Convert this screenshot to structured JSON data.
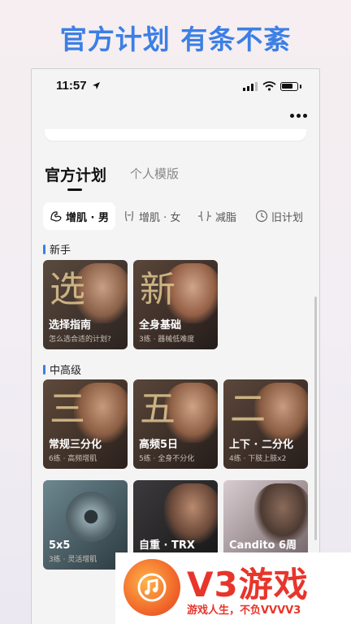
{
  "headline": "官方计划 有条不紊",
  "status": {
    "time": "11:57"
  },
  "tabs": {
    "official": "官方计划",
    "personal": "个人模版"
  },
  "chips": [
    {
      "label": "增肌 · 男",
      "icon": "muscle-arm-icon"
    },
    {
      "label": "增肌 · 女",
      "icon": "female-torso-icon"
    },
    {
      "label": "减脂",
      "icon": "fat-loss-icon"
    },
    {
      "label": "旧计划",
      "icon": "clock-icon"
    }
  ],
  "sections": {
    "beginner": "新手",
    "advanced": "中高级"
  },
  "beginner_cards": [
    {
      "char": "选",
      "title": "选择指南",
      "sub": "怎么选合适的计划?"
    },
    {
      "char": "新",
      "title": "全身基础",
      "sub": "3练 · 器械低难度"
    }
  ],
  "advanced_cards": [
    {
      "char": "三",
      "title": "常规三分化",
      "sub": "6练 · 高频增肌"
    },
    {
      "char": "五",
      "title": "高频5日",
      "sub": "5练 · 全身不分化"
    },
    {
      "char": "二",
      "title": "上下 · 二分化",
      "sub": "4练 · 下肢上肢x2"
    },
    {
      "char": "",
      "title": "5x5",
      "sub": "3练 · 灵活增肌"
    },
    {
      "char": "",
      "title": "自重 · TRX",
      "sub": ""
    },
    {
      "char": "",
      "title": "Candito 6周",
      "sub": ""
    }
  ],
  "watermark": {
    "brand": "V3游戏",
    "slogan": "游戏人生，不负VVVV3"
  },
  "colors": {
    "accent": "#3c7fe6",
    "card_gold": "#d9bf8c",
    "brand_red": "#e8352b"
  }
}
